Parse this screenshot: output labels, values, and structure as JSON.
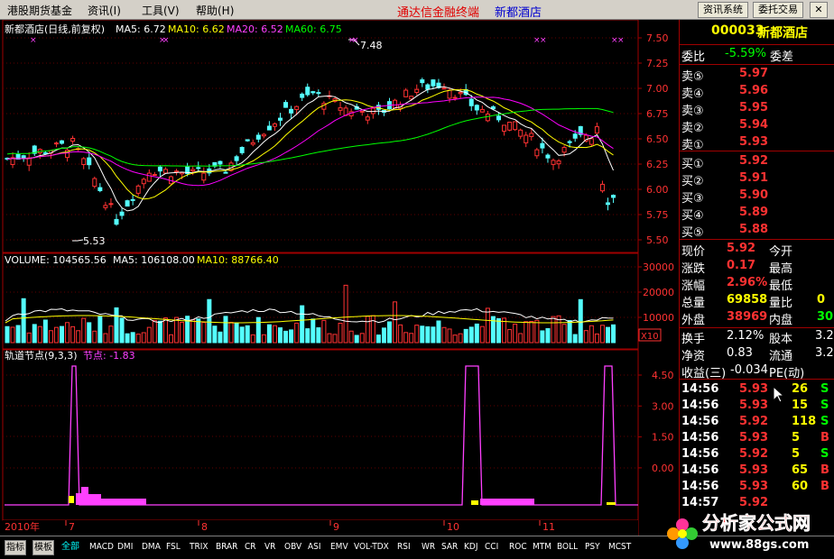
{
  "menubar": {
    "items": [
      "港股期货基金",
      "资讯(I)",
      "工具(V)",
      "帮助(H)"
    ],
    "title": "通达信金融终端",
    "stock_name": "新都酒店",
    "buttons": [
      "资讯系统",
      "委托交易"
    ]
  },
  "main_chart": {
    "header": {
      "name": "新都酒店(日线,前复权)",
      "ma5": "MA5: 6.72",
      "ma10": "MA10: 6.62",
      "ma20": "MA20: 6.52",
      "ma60": "MA60: 6.75"
    },
    "high_label": "7.48",
    "low_label": "5.53",
    "price_ticks": [
      "7.50",
      "7.25",
      "7.00",
      "6.75",
      "6.50",
      "6.25",
      "6.00",
      "5.75",
      "5.50"
    ]
  },
  "volume_chart": {
    "header": {
      "label": "VOLUME: 104565.56",
      "ma5": "MA5: 106108.00",
      "ma10": "MA10: 88766.40"
    },
    "ticks": [
      "30000",
      "20000",
      "10000"
    ],
    "unit": "X10"
  },
  "indicator_chart": {
    "header": {
      "name": "轨道节点(9,3,3)",
      "node": "节点: -1.83"
    },
    "ticks": [
      "4.50",
      "3.00",
      "1.50",
      "0.00"
    ]
  },
  "time_axis": {
    "year": "2010年",
    "months": [
      "7",
      "8",
      "9",
      "10",
      "11"
    ]
  },
  "quote_panel": {
    "code": "000033",
    "name": "新都酒店",
    "weibi_label": "委比",
    "weibi_value": "-5.59%",
    "weicha_label": "委差",
    "asks": [
      {
        "label": "卖⑤",
        "price": "5.97"
      },
      {
        "label": "卖④",
        "price": "5.96"
      },
      {
        "label": "卖③",
        "price": "5.95"
      },
      {
        "label": "卖②",
        "price": "5.94"
      },
      {
        "label": "卖①",
        "price": "5.93"
      }
    ],
    "bids": [
      {
        "label": "买①",
        "price": "5.92"
      },
      {
        "label": "买②",
        "price": "5.91"
      },
      {
        "label": "买③",
        "price": "5.90"
      },
      {
        "label": "买④",
        "price": "5.89"
      },
      {
        "label": "买⑤",
        "price": "5.88"
      }
    ],
    "stats": [
      {
        "l1": "现价",
        "v1": "5.92",
        "l2": "今开",
        "v2": ""
      },
      {
        "l1": "涨跌",
        "v1": "0.17",
        "l2": "最高",
        "v2": ""
      },
      {
        "l1": "涨幅",
        "v1": "2.96%",
        "l2": "最低",
        "v2": ""
      },
      {
        "l1": "总量",
        "v1": "69858",
        "l2": "量比",
        "v2": "0"
      },
      {
        "l1": "外盘",
        "v1": "38969",
        "l2": "内盘",
        "v2": "30"
      }
    ],
    "extra": [
      {
        "l1": "换手",
        "v1": "2.12%",
        "l2": "股本",
        "v2": "3.2"
      },
      {
        "l1": "净资",
        "v1": "0.83",
        "l2": "流通",
        "v2": "3.2"
      },
      {
        "l1": "收益(三)",
        "v1": "-0.034",
        "l2": "PE(动)",
        "v2": ""
      }
    ],
    "trades": [
      {
        "time": "14:56",
        "price": "5.93",
        "vol": "26",
        "side": "S"
      },
      {
        "time": "14:56",
        "price": "5.93",
        "vol": "15",
        "side": "S"
      },
      {
        "time": "14:56",
        "price": "5.92",
        "vol": "118",
        "side": "S"
      },
      {
        "time": "14:56",
        "price": "5.93",
        "vol": "5",
        "side": "B"
      },
      {
        "time": "14:56",
        "price": "5.92",
        "vol": "5",
        "side": "S"
      },
      {
        "time": "14:56",
        "price": "5.93",
        "vol": "65",
        "side": "B"
      },
      {
        "time": "14:56",
        "price": "5.93",
        "vol": "60",
        "side": "B"
      },
      {
        "time": "14:57",
        "price": "5.92",
        "vol": "",
        "side": ""
      }
    ]
  },
  "tabs": [
    "指标",
    "模板",
    "全部",
    "MACD",
    "DMI",
    "DMA",
    "FSL",
    "TRIX",
    "BRAR",
    "CR",
    "VR",
    "OBV",
    "ASI",
    "EMV",
    "VOL-TDX",
    "RSI",
    "WR",
    "SAR",
    "KDJ",
    "CCI",
    "ROC",
    "MTM",
    "BOLL",
    "PSY",
    "MCST"
  ],
  "logo": {
    "title": "分析家公式网",
    "url": "www.88gs.com"
  },
  "colors": {
    "up": "#ff3232",
    "down": "#54ffff",
    "ma5": "#ffffff",
    "ma10": "#ffff00",
    "ma20": "#ff00ff",
    "ma60": "#00ff00"
  }
}
